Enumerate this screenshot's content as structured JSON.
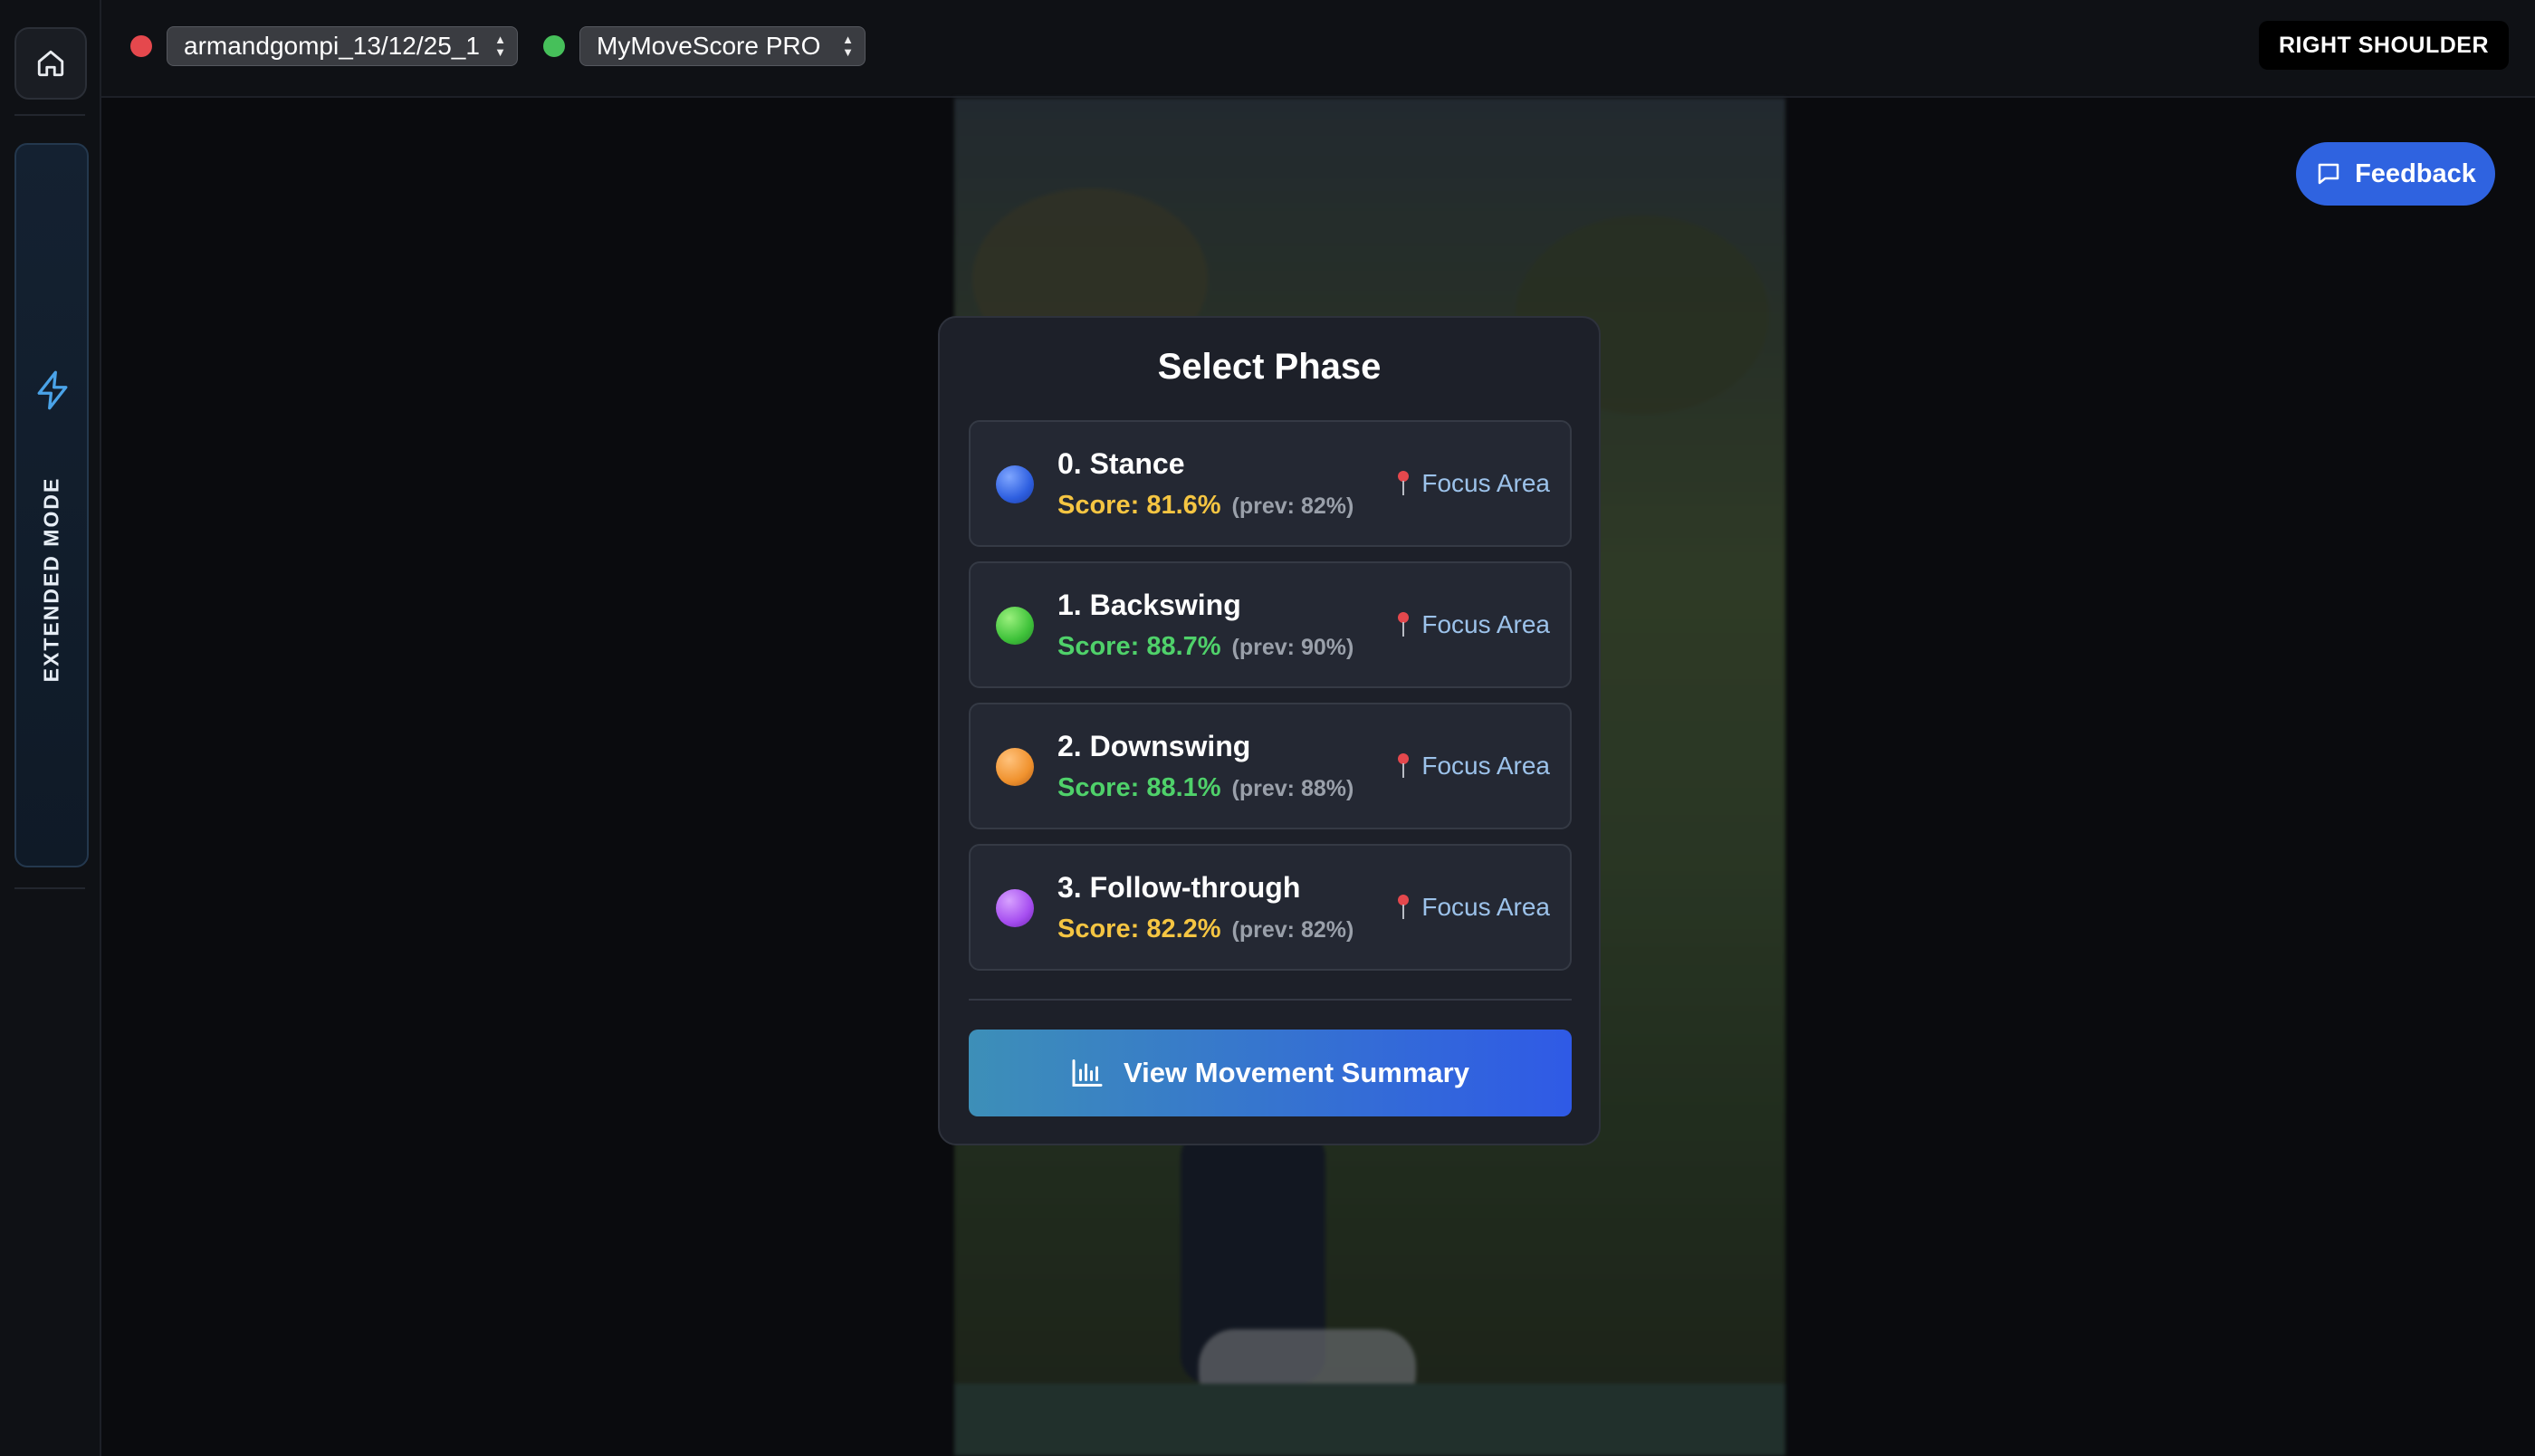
{
  "sidebar": {
    "mode_label": "EXTENDED MODE"
  },
  "topbar": {
    "session_select": "armandgompi_13/12/25_1",
    "product_select": "MyMoveScore PRO",
    "view_label": "RIGHT SHOULDER",
    "status_colors": {
      "session": "#e5484d",
      "product": "#46c05a"
    }
  },
  "feedback_label": "Feedback",
  "modal": {
    "title": "Select Phase",
    "phases": [
      {
        "name": "0. Stance",
        "score": "Score: 81.6%",
        "prev": "(prev: 82%)",
        "focus": "Focus Area",
        "ball_color": "#2e5fe0",
        "score_color": "#f5c542"
      },
      {
        "name": "1. Backswing",
        "score": "Score: 88.7%",
        "prev": "(prev: 90%)",
        "focus": "Focus Area",
        "ball_color": "#3fc23a",
        "score_color": "#4fd16a"
      },
      {
        "name": "2. Downswing",
        "score": "Score: 88.1%",
        "prev": "(prev: 88%)",
        "focus": "Focus Area",
        "ball_color": "#f0922e",
        "score_color": "#4fd16a"
      },
      {
        "name": "3. Follow-through",
        "score": "Score: 82.2%",
        "prev": "(prev: 82%)",
        "focus": "Focus Area",
        "ball_color": "#a64ef0",
        "score_color": "#f5c542"
      }
    ],
    "summary_button": "View Movement Summary"
  }
}
